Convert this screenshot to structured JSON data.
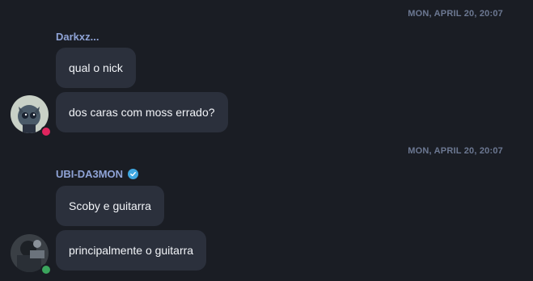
{
  "messages": [
    {
      "timestamp": "MON, APRIL 20, 20:07",
      "sender": "Darkxz...",
      "verified": false,
      "status_color": "#e0245e",
      "bubbles": [
        "qual o nick",
        "dos caras com moss errado?"
      ]
    },
    {
      "timestamp": "MON, APRIL 20, 20:07",
      "sender": "UBI-DA3MON",
      "verified": true,
      "status_color": "#3ba55d",
      "bubbles": [
        "Scoby e guitarra",
        "principalmente o guitarra"
      ]
    }
  ],
  "icons": {
    "verified": "verified-check-icon"
  }
}
